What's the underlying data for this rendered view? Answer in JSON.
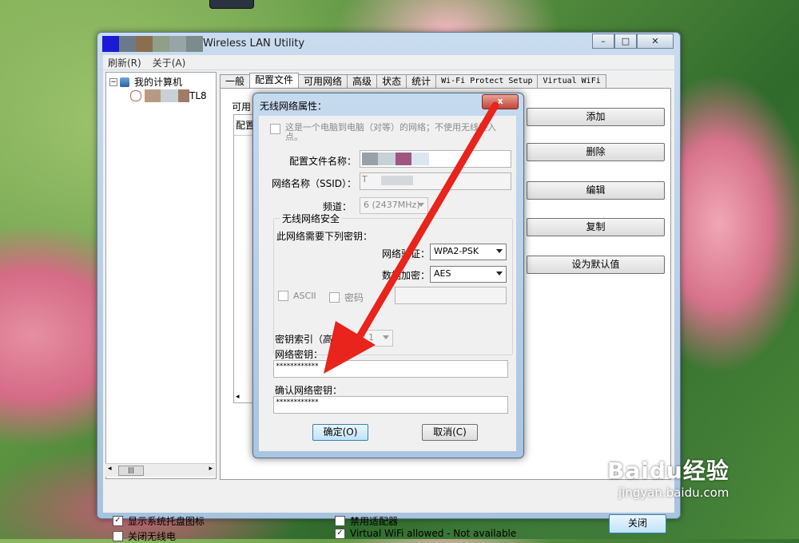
{
  "window": {
    "title": "Wireless LAN Utility",
    "menu": [
      "刷新(R)",
      "关于(A)"
    ]
  },
  "tree": {
    "root": "我的计算机",
    "adapter_suffix": "TL8"
  },
  "tabs": [
    "一般",
    "配置文件",
    "可用网络",
    "高级",
    "状态",
    "统计",
    "Wi-Fi Protect Setup",
    "Virtual WiFi"
  ],
  "profiles_panel": {
    "label_prefix": "可用",
    "list_header": "配置",
    "buttons": [
      "添加",
      "删除",
      "编辑",
      "复制",
      "设为默认值"
    ]
  },
  "bottom": {
    "show_tray_icon": "显示系统托盘图标",
    "disable_radio": "关闭无线电",
    "disable_adapter": "禁用适配器",
    "virtual_wifi": "Virtual WiFi allowed - Not available",
    "exit_btn": "关闭"
  },
  "dialog": {
    "title": "无线网络属性：",
    "close_icon": "x",
    "adhoc_label": "这是一个电脑到电脑（对等）的网络；不使用无线接入点。",
    "profile_name_label": "配置文件名称：",
    "ssid_label": "网络名称（SSID）：",
    "ssid_value": "T",
    "channel_label": "频道：",
    "channel_value": "6 (2437MHz)",
    "security_group": "无线网络安全",
    "needs_key": "此网络需要下列密钥：",
    "auth_label": "网络验证：",
    "auth_value": "WPA2-PSK",
    "enc_label": "数据加密：",
    "enc_value": "AES",
    "ascii_label": "ASCII",
    "passphrase_label": "密码",
    "key_index_label": "密钥索引（高级）：",
    "key_index_value": "1",
    "net_key_label": "网络密钥：",
    "net_key_value": "************",
    "confirm_key_label": "确认网络密钥：",
    "confirm_key_value": "************",
    "ok": "确定(O)",
    "cancel": "取消(C)"
  },
  "watermark": {
    "brand": "Baidu经验",
    "url": "jingyan.baidu.com"
  },
  "colors": {
    "arrow": "#e8241c",
    "title_strip": [
      "#1b1bd6",
      "#6b7a8a",
      "#8a6f4e",
      "#8f9f88",
      "#96a6a6",
      "#7c8c8c"
    ],
    "profile_blur": [
      "#9aa0a8",
      "#c6d2d6",
      "#a05683",
      "#dbe7ee"
    ]
  }
}
